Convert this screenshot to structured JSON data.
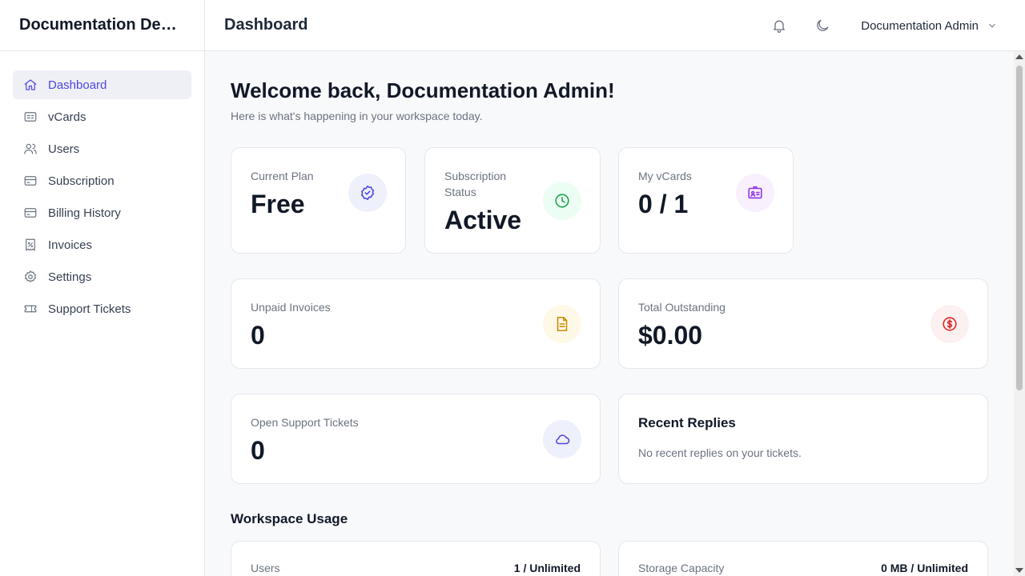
{
  "sidebar": {
    "brand": "Documentation Demo",
    "items": [
      {
        "label": "Dashboard",
        "icon": "home-icon",
        "active": true
      },
      {
        "label": "vCards",
        "icon": "vcard-icon"
      },
      {
        "label": "Users",
        "icon": "users-icon"
      },
      {
        "label": "Subscription",
        "icon": "credit-card-icon"
      },
      {
        "label": "Billing History",
        "icon": "credit-card-icon"
      },
      {
        "label": "Invoices",
        "icon": "receipt-icon"
      },
      {
        "label": "Settings",
        "icon": "gear-icon"
      },
      {
        "label": "Support Tickets",
        "icon": "ticket-icon"
      }
    ]
  },
  "header": {
    "title": "Dashboard",
    "user_name": "Documentation Admin"
  },
  "welcome": {
    "title": "Welcome back, Documentation Admin!",
    "subtitle": "Here is what's happening in your workspace today."
  },
  "stats": {
    "current_plan": {
      "label": "Current Plan",
      "value": "Free",
      "color": "#4f46e5",
      "bg": "#eef0fb"
    },
    "subscription_status": {
      "label": "Subscription Status",
      "value": "Active",
      "color": "#16a34a",
      "bg": "#ecfdf3"
    },
    "my_vcards": {
      "label": "My vCards",
      "value": "0 / 1",
      "color": "#9333ea",
      "bg": "#f8f0fd"
    },
    "unpaid_invoices": {
      "label": "Unpaid Invoices",
      "value": "0",
      "color": "#ca8a04",
      "bg": "#fef9e7"
    },
    "total_outstanding": {
      "label": "Total Outstanding",
      "value": "$0.00",
      "color": "#dc2626",
      "bg": "#fdf0f0"
    },
    "open_tickets": {
      "label": "Open Support Tickets",
      "value": "0",
      "color": "#4f46e5",
      "bg": "#eef0fb"
    }
  },
  "recent_replies": {
    "title": "Recent Replies",
    "empty": "No recent replies on your tickets."
  },
  "usage": {
    "title": "Workspace Usage",
    "users": {
      "label": "Users",
      "value": "1 / Unlimited"
    },
    "storage": {
      "label": "Storage Capacity",
      "value": "0 MB / Unlimited"
    }
  }
}
